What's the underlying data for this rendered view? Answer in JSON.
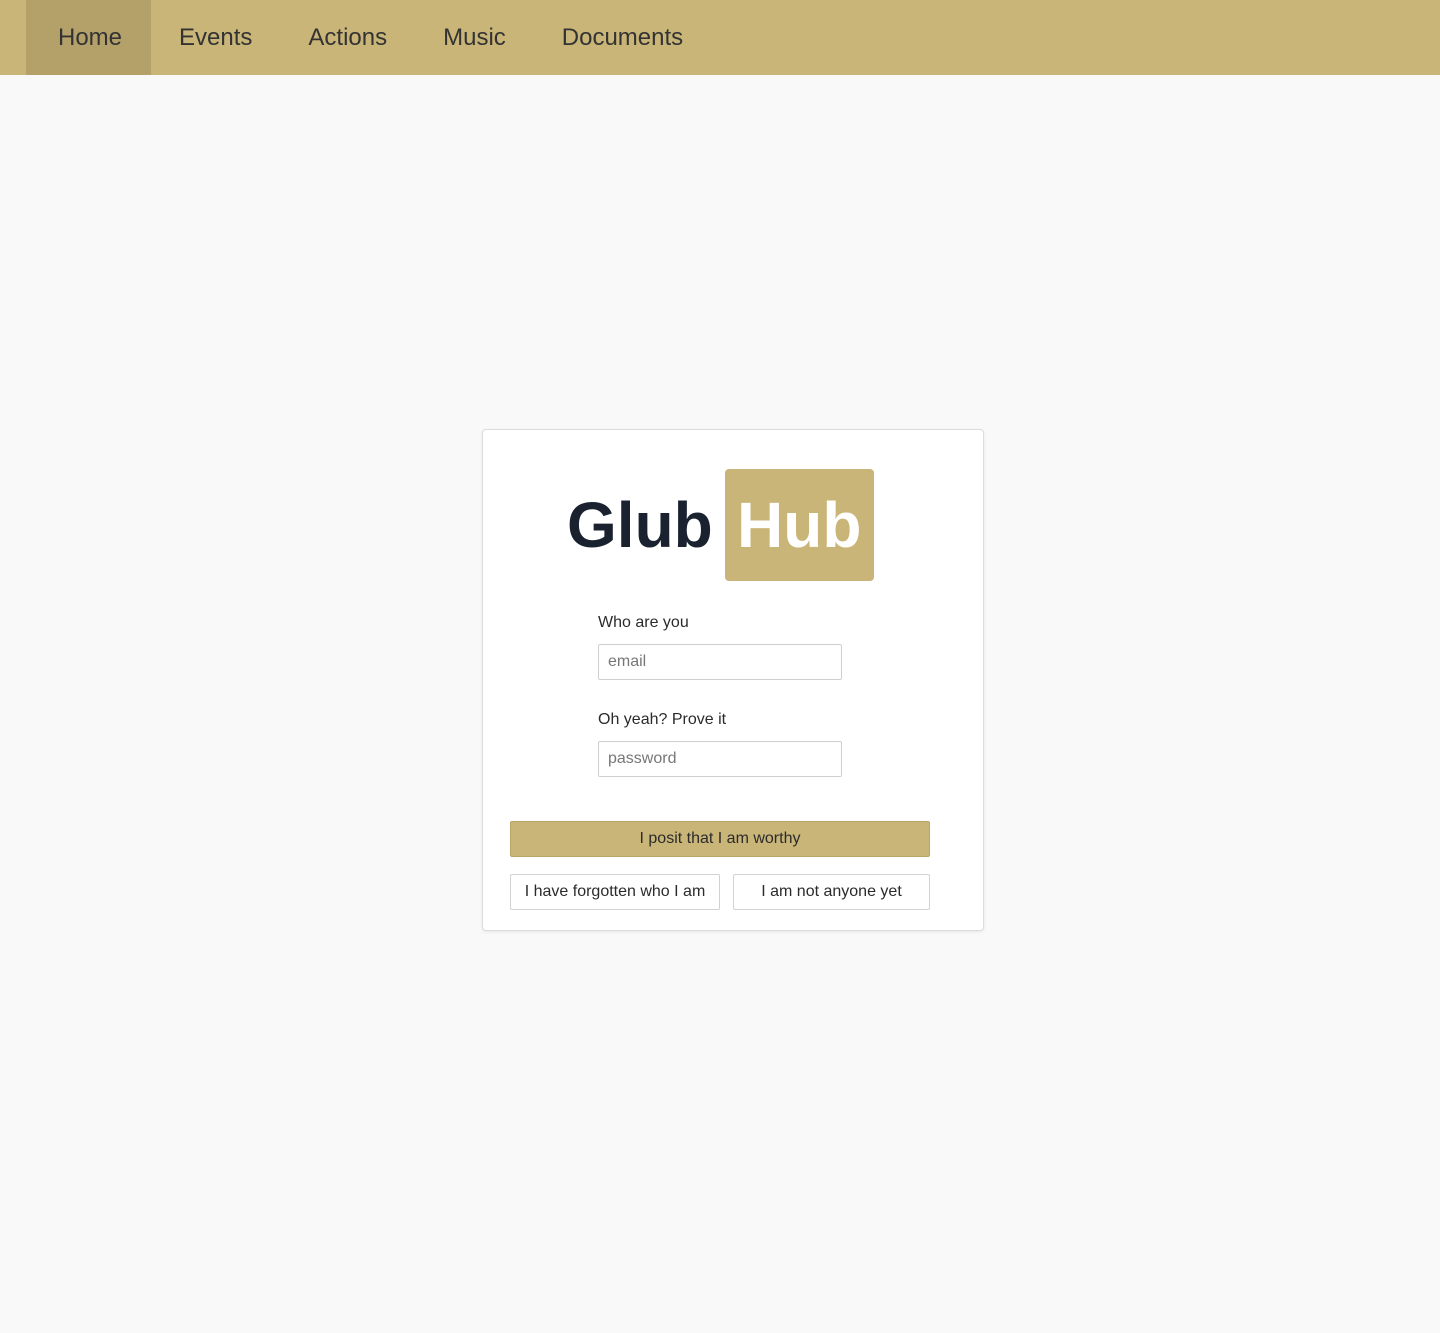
{
  "nav": {
    "items": [
      {
        "label": "Home",
        "active": true
      },
      {
        "label": "Events"
      },
      {
        "label": "Actions"
      },
      {
        "label": "Music"
      },
      {
        "label": "Documents"
      }
    ]
  },
  "logo": {
    "part1": "Glub",
    "part2": "Hub"
  },
  "login": {
    "email_label": "Who are you",
    "email_placeholder": "email",
    "email_value": "",
    "password_label": "Oh yeah? Prove it",
    "password_placeholder": "password",
    "password_value": "",
    "submit_label": "I posit that I am worthy",
    "forgot_label": "I have forgotten who I am",
    "signup_label": "I am not anyone yet"
  },
  "colors": {
    "accent": "#c9b577",
    "accent_active": "#b4a16a",
    "logo_dark": "#1a2230",
    "background": "#f9f9f9"
  }
}
